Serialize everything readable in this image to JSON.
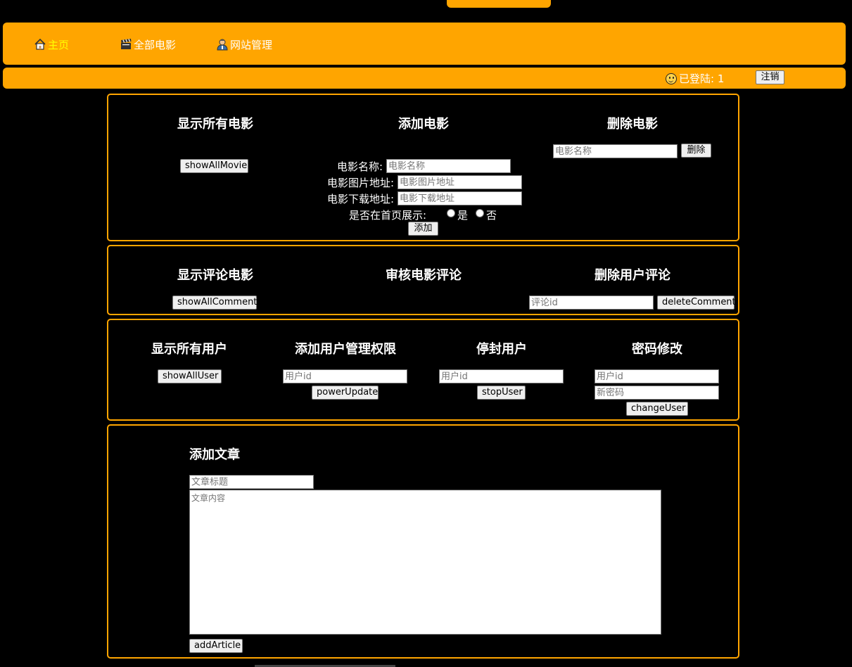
{
  "nav": {
    "home": "主页",
    "all_movies": "全部电影",
    "site_admin": "网站管理"
  },
  "status": {
    "logged_in": "已登陆: 1",
    "logout": "注销"
  },
  "movie_panel": {
    "show_title": "显示所有电影",
    "show_button": "showAllMovie",
    "add_title": "添加电影",
    "name_label": "电影名称:",
    "name_placeholder": "电影名称",
    "image_label": "电影图片地址:",
    "image_placeholder": "电影图片地址",
    "download_label": "电影下载地址:",
    "download_placeholder": "电影下载地址",
    "homepage_label": "是否在首页展示:",
    "yes": "是",
    "no": "否",
    "add_button": "添加",
    "delete_title": "删除电影",
    "delete_placeholder": "电影名称",
    "delete_button": "删除"
  },
  "comment_panel": {
    "show_title": "显示评论电影",
    "show_button": "showAllComment",
    "review_title": "审核电影评论",
    "delete_title": "删除用户评论",
    "delete_placeholder": "评论id",
    "delete_button": "deleteComment"
  },
  "user_panel": {
    "show_title": "显示所有用户",
    "show_button": "showAllUser",
    "power_title": "添加用户管理权限",
    "power_placeholder": "用户id",
    "power_button": "powerUpdate",
    "stop_title": "停封用户",
    "stop_placeholder": "用户id",
    "stop_button": "stopUser",
    "password_title": "密码修改",
    "password_user_placeholder": "用户id",
    "password_new_placeholder": "新密码",
    "password_button": "changeUser"
  },
  "article_panel": {
    "title": "添加文章",
    "title_placeholder": "文章标题",
    "content_placeholder": "文章内容",
    "add_button": "addArticle"
  },
  "colors": {
    "accent": "#ffa500",
    "active_nav": "#ffff00",
    "background": "#000000"
  },
  "icons": {
    "home": "house-icon",
    "movies": "clapperboard-icon",
    "admin": "admin-user-icon",
    "status": "smiley-icon"
  }
}
